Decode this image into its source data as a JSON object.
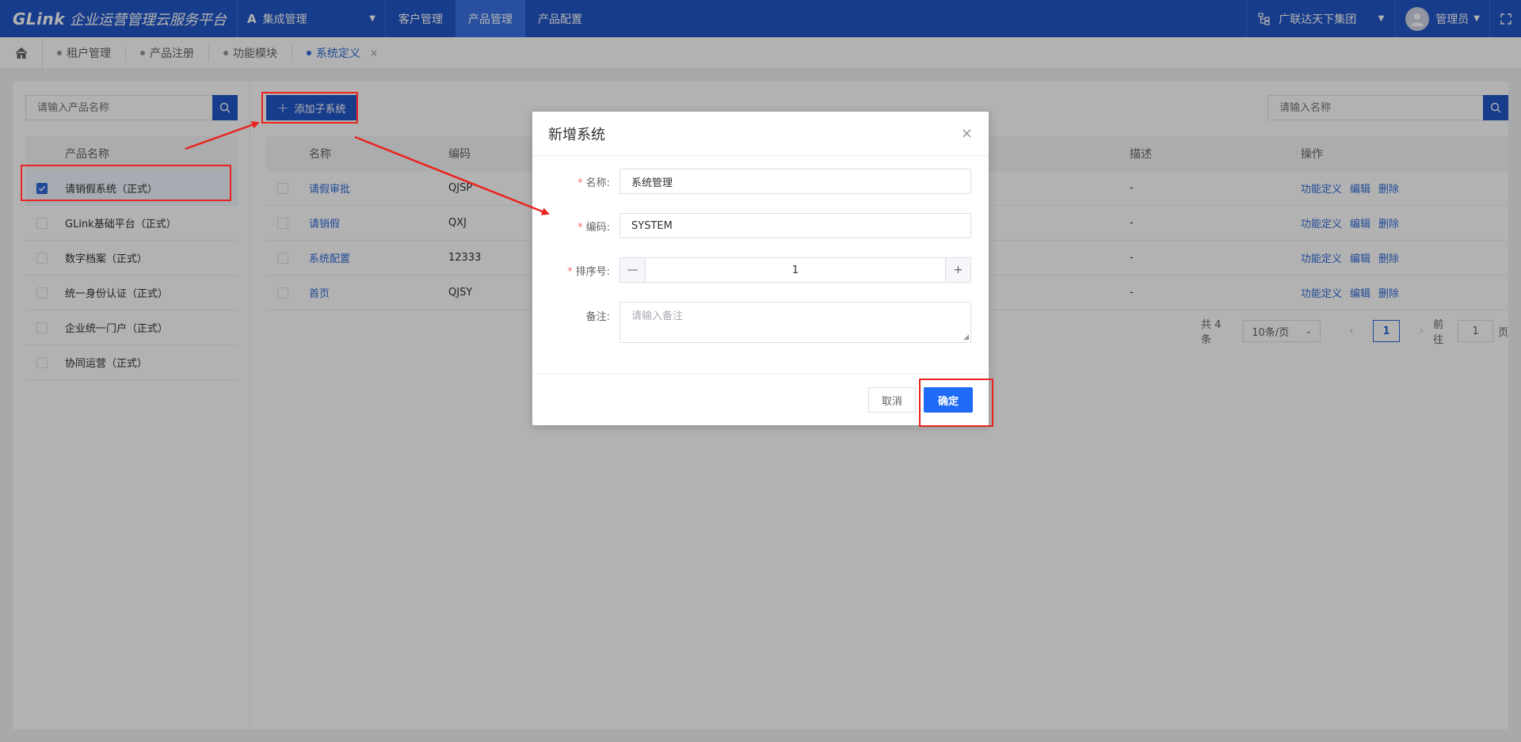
{
  "header": {
    "logo_mark": "GLink",
    "app_title": "企业运营管理云服务平台",
    "system_select": "集成管理",
    "nav": [
      "客户管理",
      "产品管理",
      "产品配置"
    ],
    "active_nav": "产品管理",
    "org": "广联达天下集团",
    "user": "管理员"
  },
  "tabs": {
    "items": [
      "租户管理",
      "产品注册",
      "功能模块",
      "系统定义"
    ],
    "active": "系统定义",
    "close_glyph": "×"
  },
  "left": {
    "search_placeholder": "请输入产品名称",
    "column": "产品名称",
    "products": [
      {
        "label": "请销假系统（正式）",
        "checked": true
      },
      {
        "label": "GLink基础平台（正式）",
        "checked": false
      },
      {
        "label": "数字档案（正式）",
        "checked": false
      },
      {
        "label": "统一身份认证（正式）",
        "checked": false
      },
      {
        "label": "企业统一门户（正式）",
        "checked": false
      },
      {
        "label": "协同运营（正式）",
        "checked": false
      }
    ]
  },
  "right": {
    "add_button": "添加子系统",
    "search_placeholder": "请输入名称",
    "columns": {
      "name": "名称",
      "code": "编码",
      "desc": "描述",
      "ops": "操作"
    },
    "rows": [
      {
        "name": "请假审批",
        "code": "QJSP",
        "desc": "-"
      },
      {
        "name": "请销假",
        "code": "QXJ",
        "desc": "-"
      },
      {
        "name": "系统配置",
        "code": "12333",
        "desc": "-"
      },
      {
        "name": "首页",
        "code": "QJSY",
        "desc": "-"
      }
    ],
    "ops": {
      "func": "功能定义",
      "edit": "编辑",
      "del": "删除"
    },
    "pager": {
      "total": "共 4 条",
      "size": "10条/页",
      "page": "1",
      "goto_prefix": "前往",
      "goto_value": "1",
      "goto_suffix": "页"
    }
  },
  "dialog": {
    "title": "新增系统",
    "close_glyph": "×",
    "name_label": "名称:",
    "name_value": "系统管理",
    "code_label": "编码:",
    "code_value": "SYSTEM",
    "order_label": "排序号:",
    "order_value": "1",
    "minus": "—",
    "plus": "+",
    "remark_label": "备注:",
    "remark_placeholder": "请输入备注",
    "cancel": "取消",
    "ok": "确定"
  },
  "colors": {
    "primary": "#2156c8",
    "link": "#2f6bd8",
    "ok": "#1f6bf5",
    "annotation": "#e8251f"
  }
}
